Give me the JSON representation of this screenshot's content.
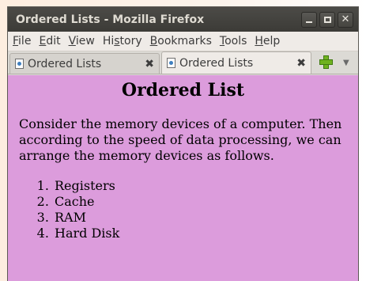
{
  "window": {
    "title": "Ordered Lists - Mozilla Firefox"
  },
  "menu": [
    {
      "label": "File",
      "key": "F",
      "rest": "ile"
    },
    {
      "label": "Edit",
      "key": "E",
      "rest": "dit"
    },
    {
      "label": "View",
      "key": "V",
      "rest": "iew"
    },
    {
      "label": "History",
      "pre": "Hi",
      "key": "s",
      "rest": "tory"
    },
    {
      "label": "Bookmarks",
      "key": "B",
      "rest": "ookmarks"
    },
    {
      "label": "Tools",
      "key": "T",
      "rest": "ools"
    },
    {
      "label": "Help",
      "key": "H",
      "rest": "elp"
    }
  ],
  "tabs": [
    {
      "label": "Ordered Lists",
      "active": false
    },
    {
      "label": "Ordered Lists",
      "active": true
    }
  ],
  "page": {
    "heading": "Ordered List",
    "paragraph": "Consider the memory devices of a computer. Then according to the speed of data processing, we can arrange the memory devices as follows.",
    "list": [
      "Registers",
      "Cache",
      "RAM",
      "Hard Disk"
    ]
  },
  "colors": {
    "page_background": "#dc9cdc",
    "titlebar": "#3c3b37"
  },
  "icons": {
    "close_tab": "close-tab-icon",
    "new_tab": "plus-icon",
    "tab_list": "chevron-down-icon",
    "favicon": "page-icon"
  }
}
